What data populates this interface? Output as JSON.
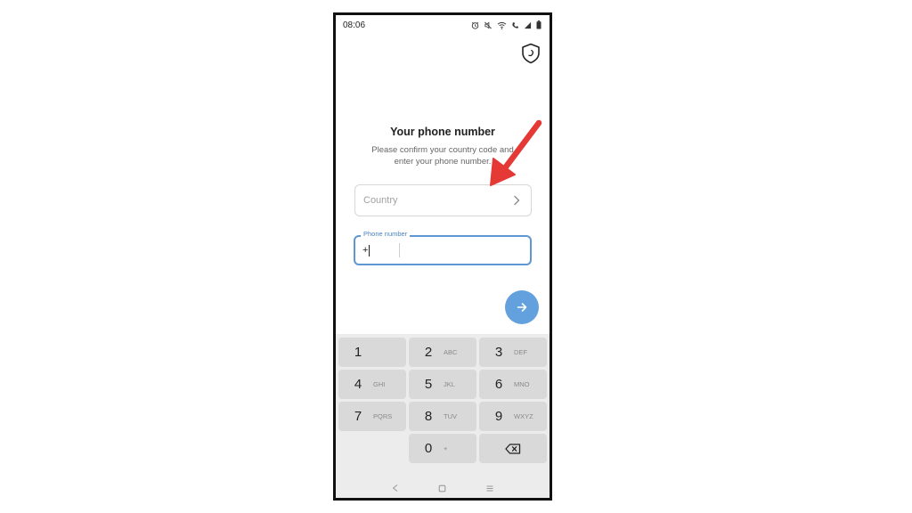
{
  "status_bar": {
    "time": "08:06",
    "icons": [
      "alarm-icon",
      "mute-icon",
      "wifi-icon",
      "call-signal-icon",
      "signal-icon",
      "battery-icon"
    ]
  },
  "header": {
    "shield_icon": "shield-icon"
  },
  "main": {
    "title": "Your phone number",
    "subtitle": "Please confirm your country code and enter your phone number.",
    "country_field": {
      "placeholder": "Country",
      "icon": "chevron-right-icon"
    },
    "phone_field": {
      "label": "Phone number",
      "prefix": "+",
      "value": ""
    },
    "next_button": {
      "icon": "arrow-right-icon",
      "color": "#62a1dd"
    }
  },
  "keypad": {
    "keys": [
      {
        "digit": "1",
        "letters": ""
      },
      {
        "digit": "2",
        "letters": "ABC"
      },
      {
        "digit": "3",
        "letters": "DEF"
      },
      {
        "digit": "4",
        "letters": "GHI"
      },
      {
        "digit": "5",
        "letters": "JKL"
      },
      {
        "digit": "6",
        "letters": "MNO"
      },
      {
        "digit": "7",
        "letters": "PQRS"
      },
      {
        "digit": "8",
        "letters": "TUV"
      },
      {
        "digit": "9",
        "letters": "WXYZ"
      },
      {
        "digit": "0",
        "letters": "+"
      }
    ],
    "backspace_icon": "backspace-icon"
  },
  "nav_bar": {
    "icons": [
      "back-icon",
      "home-icon",
      "recents-icon"
    ]
  },
  "annotation": {
    "arrow_color": "#e53935"
  }
}
